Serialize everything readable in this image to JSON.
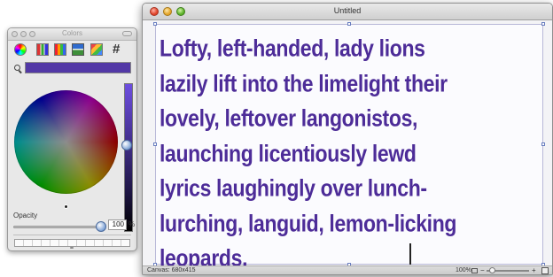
{
  "colors_panel": {
    "title": "Colors",
    "toolbar_icons": [
      "color-wheel-icon",
      "color-sliders-icon",
      "color-palettes-icon",
      "image-palettes-icon",
      "crayons-icon",
      "hash-icon"
    ],
    "hash_glyph": "#",
    "current_color": "#5238a6",
    "opacity_label": "Opacity",
    "opacity_value": "100",
    "opacity_unit": "%",
    "opacity_level": 1.0,
    "brightness_level": 0.6
  },
  "document_window": {
    "title": "Untitled",
    "text": "Lofty, left-handed, lady lions\nlazily lift into the limelight their\nlovely, leftover langonistos,\nlaunching licentiously lewd\nlyrics laughingly over lunch-\nlurching, languid, lemon-licking\nleopards.",
    "text_color": "#4d2c98",
    "status": {
      "canvas_size": "Canvas: 680x415",
      "zoom": "100%",
      "zoom_level": 0.1
    }
  }
}
